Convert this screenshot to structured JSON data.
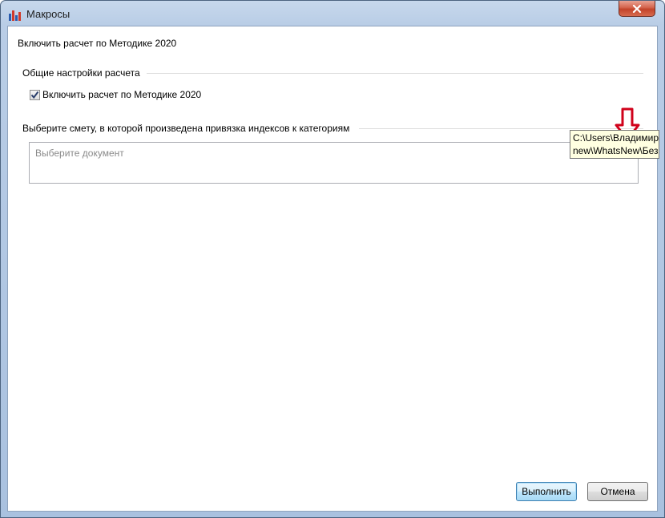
{
  "window": {
    "title": "Макросы",
    "icon": "macro-app-icon"
  },
  "header": {
    "label": "Включить расчет по Методике 2020"
  },
  "general_settings": {
    "title": "Общие настройки расчета",
    "checkbox_label": "Включить расчет по Методике 2020",
    "checkbox_checked": true
  },
  "document_select": {
    "title": "Выберите смету, в которой произведена привязка индексов к категориям",
    "placeholder": "Выберите документ"
  },
  "tooltip": {
    "line1": "C:\\Users\\Владимир",
    "line2": "new\\WhatsNew\\Без"
  },
  "annotation": {
    "arrow_color": "#d0021b",
    "arrow_icon": "down-arrow-icon"
  },
  "buttons": {
    "execute": "Выполнить",
    "cancel": "Отмена"
  }
}
